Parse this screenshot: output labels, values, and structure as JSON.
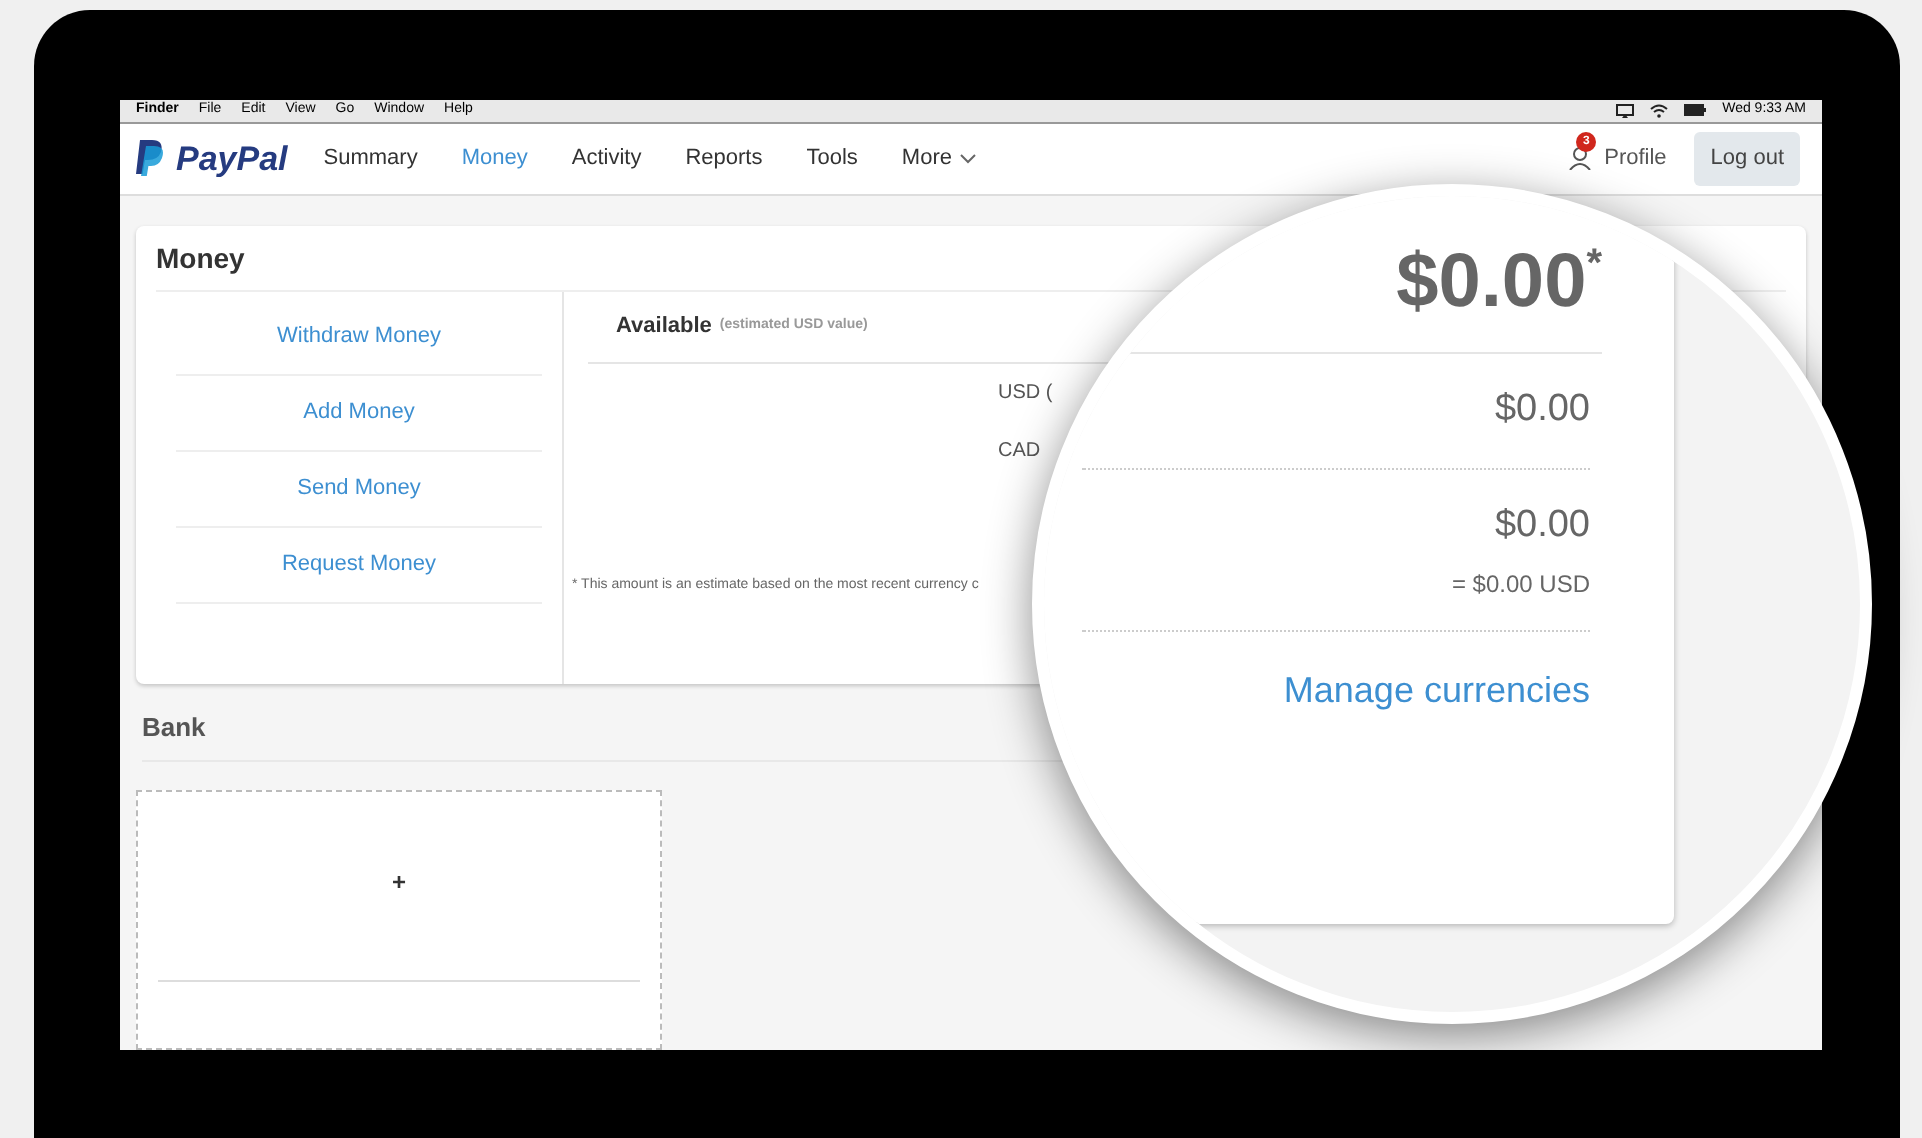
{
  "menu_bar": {
    "app": "Finder",
    "items": [
      "File",
      "Edit",
      "View",
      "Go",
      "Window",
      "Help"
    ],
    "clock": "Wed 9:33 AM"
  },
  "nav": {
    "logo": "PayPal",
    "items": [
      {
        "label": "Summary",
        "selected": false
      },
      {
        "label": "Money",
        "selected": true
      },
      {
        "label": "Activity",
        "selected": false
      },
      {
        "label": "Reports",
        "selected": false
      },
      {
        "label": "Tools",
        "selected": false
      }
    ],
    "more": "More",
    "notifications": "3",
    "profile": "Profile",
    "logout": "Log out"
  },
  "money_card": {
    "title": "Money",
    "actions": [
      "Withdraw Money",
      "Add Money",
      "Send Money",
      "Request Money"
    ],
    "available_label": "Available",
    "available_note": "(estimated USD value)",
    "currency_rows": [
      "USD (",
      "CAD"
    ],
    "footnote": "* This amount is an estimate based on the most recent currency c"
  },
  "bank": {
    "title": "Bank",
    "add": "+"
  },
  "magnifier": {
    "total": "$0.00",
    "total_mark": "*",
    "rows": [
      {
        "amount": "$0.00"
      },
      {
        "amount": "$0.00",
        "converted": "= $0.00 USD"
      }
    ],
    "link": "Manage currencies"
  }
}
